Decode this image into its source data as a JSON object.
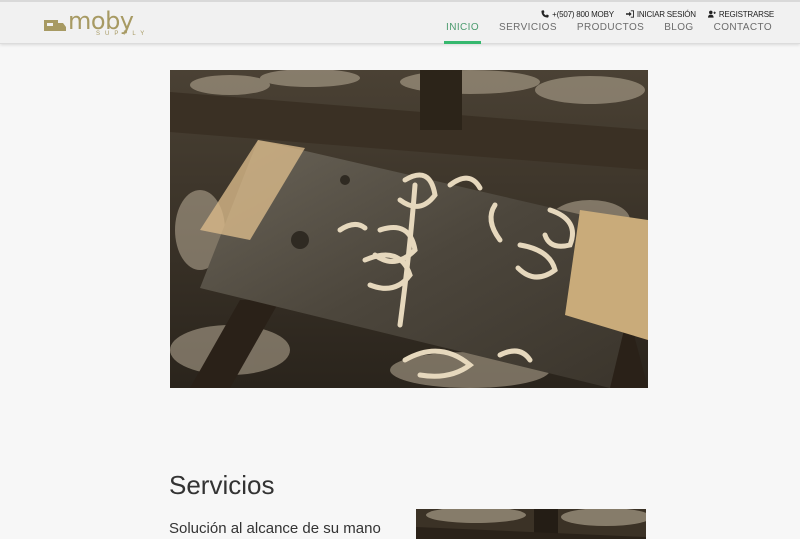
{
  "brand": {
    "name": "moby",
    "tagline": "SUPPLY"
  },
  "topbar": {
    "phone": "+(507) 800 MOBY",
    "login": "INICIAR SESIÓN",
    "register": "REGISTRARSE"
  },
  "nav": {
    "items": [
      {
        "label": "INICIO",
        "active": true
      },
      {
        "label": "SERVICIOS",
        "active": false
      },
      {
        "label": "PRODUCTOS",
        "active": false
      },
      {
        "label": "BLOG",
        "active": false
      },
      {
        "label": "CONTACTO",
        "active": false
      }
    ]
  },
  "hero": {
    "image": "wooden-workbench-with-wood-shavings"
  },
  "services": {
    "title": "Servicios",
    "subtitle": "Solución al alcance de su mano"
  },
  "colors": {
    "brand_gold": "#a79a63",
    "accent_green": "#36b86e",
    "nav_text": "#6c6c6c",
    "page_bg": "#f7f7f7"
  }
}
